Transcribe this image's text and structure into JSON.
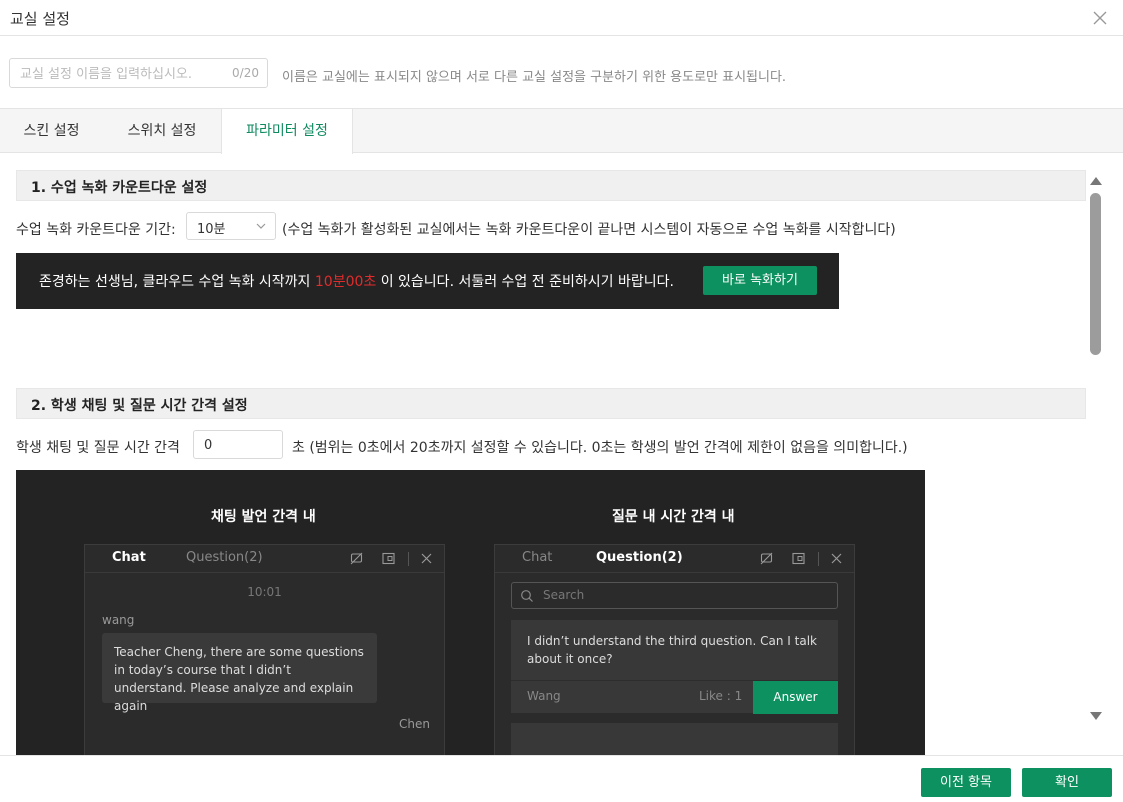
{
  "dialog": {
    "title": "교실 설정",
    "close_icon": "close-icon"
  },
  "name_field": {
    "placeholder": "교실 설정 이름을 입력하십시오.",
    "value": "",
    "counter": "0/20",
    "hint": "이름은 교실에는 표시되지 않으며 서로 다른 교실 설정을 구분하기 위한 용도로만 표시됩니다."
  },
  "tabs": [
    {
      "label": "스킨 설정",
      "active": false
    },
    {
      "label": "스위치 설정",
      "active": false
    },
    {
      "label": "파라미터 설정",
      "active": true
    }
  ],
  "section1": {
    "title": "1. 수업 녹화 카운트다운 설정",
    "label": "수업 녹화 카운트다운 기간:",
    "select_value": "10분",
    "note": "(수업 녹화가 활성화된 교실에서는 녹화 카운트다운이 끝나면 시스템이 자동으로 수업 녹화를 시작합니다)",
    "banner": {
      "before": "존경하는 선생님, 클라우드 수업 녹화 시작까지 ",
      "time": "10분00초",
      "after": " 이 있습니다. 서둘러 수업 전 준비하시기 바랍니다.",
      "button": "바로 녹화하기"
    }
  },
  "section2": {
    "title": "2. 학생 채팅 및 질문 시간 간격 설정",
    "label": "학생 채팅 및 질문 시간 간격",
    "value": "0",
    "note": "초 (범위는 0초에서 20초까지 설정할 수 있습니다. 0초는 학생의 발언 간격에 제한이 없음을 의미합니다.)",
    "demo": {
      "left_title": "채팅 발언 간격 내",
      "right_title": "질문 내 시간 간격 내",
      "chat_panel": {
        "tab_chat": "Chat",
        "tab_question": "Question(2)",
        "time": "10:01",
        "user": "wang",
        "message": "Teacher Cheng, there are some questions in today’s course that I didn’t understand. Please analyze and explain again",
        "next_user": "Chen"
      },
      "question_panel": {
        "tab_chat": "Chat",
        "tab_question": "Question(2)",
        "search_placeholder": "Search",
        "question": "I didn’t understand the third question. Can I talk about it once?",
        "asker": "Wang",
        "like": "Like : 1",
        "answer_button": "Answer"
      }
    }
  },
  "footer": {
    "prev_button": "이전 항목",
    "confirm_button": "확인"
  },
  "colors": {
    "accent": "#0e9160",
    "active_tab_text": "#0f8a5f",
    "countdown_red": "#e02c2c",
    "demo_bg": "#232323"
  }
}
